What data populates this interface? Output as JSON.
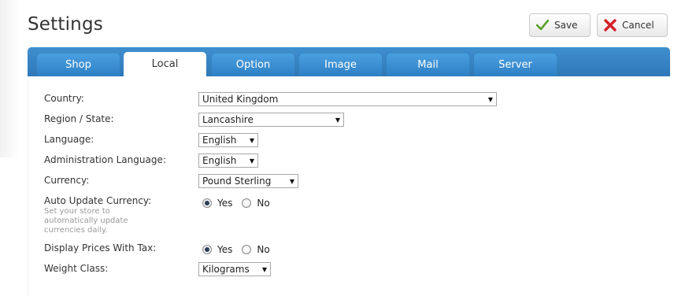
{
  "header": {
    "title": "Settings",
    "save_label": "Save",
    "cancel_label": "Cancel"
  },
  "tabs": [
    {
      "label": "Shop"
    },
    {
      "label": "Local",
      "active": true
    },
    {
      "label": "Option"
    },
    {
      "label": "Image"
    },
    {
      "label": "Mail"
    },
    {
      "label": "Server"
    }
  ],
  "form": {
    "country": {
      "label": "Country:",
      "value": "United Kingdom"
    },
    "region": {
      "label": "Region / State:",
      "value": "Lancashire"
    },
    "language": {
      "label": "Language:",
      "value": "English"
    },
    "admin_language": {
      "label": "Administration Language:",
      "value": "English"
    },
    "currency": {
      "label": "Currency:",
      "value": "Pound Sterling"
    },
    "auto_update": {
      "label": "Auto Update Currency:",
      "help": "Set your store to automatically update currencies daily.",
      "yes": "Yes",
      "no": "No",
      "selected": "Yes"
    },
    "display_tax": {
      "label": "Display Prices With Tax:",
      "yes": "Yes",
      "no": "No",
      "selected": "Yes"
    },
    "weight_class": {
      "label": "Weight Class:",
      "value": "Kilograms"
    }
  },
  "colors": {
    "tab_bar": "#3a89cb",
    "save_check": "#5aa02c",
    "cancel_x": "#d6202a"
  },
  "icons": {
    "save": "check-icon",
    "cancel": "x-icon",
    "dropdown": "chevron-down-icon"
  }
}
